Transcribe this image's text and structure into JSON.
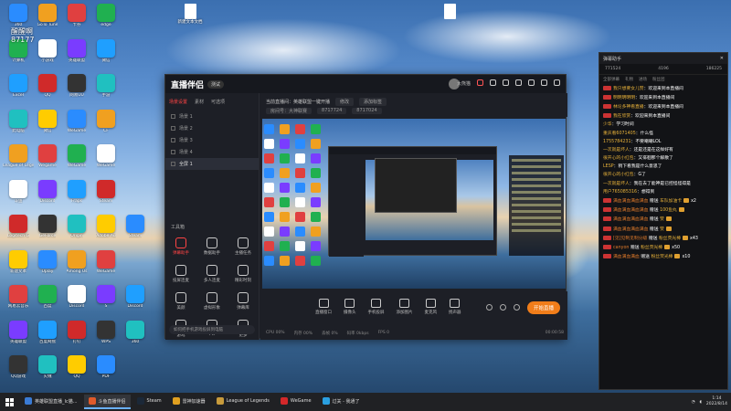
{
  "desktop": {
    "overlay_text": "醒醒啊",
    "overlay_num": "87177",
    "row_labels": [
      [
        "360",
        "GoTo Tune",
        "卡券",
        "edge",
        "",
        "新建文本文档"
      ],
      [
        "计算机",
        "小游戏",
        "英雄联盟",
        "微信",
        "",
        ""
      ],
      [
        "Excel",
        "QQ",
        "网易UU",
        "手游",
        "",
        ""
      ],
      [
        "此电脑",
        "微信",
        "WeGame",
        "CF",
        "",
        ""
      ],
      [
        "League of Legends",
        "Wegame",
        "WeGame",
        "WeGame",
        "",
        ""
      ],
      [
        "斗鱼",
        "Discord",
        "Fraps",
        "Steam",
        "",
        ""
      ],
      [
        "Logitech G",
        "GeForce",
        "Origin",
        "Adobe Au",
        "Steam",
        ""
      ],
      [
        "新建文本",
        "Uplay",
        "Among Us",
        "WeGame",
        "",
        ""
      ],
      [
        "网易云音乐",
        "百度",
        "Discord",
        "S",
        "Discord",
        ""
      ],
      [
        "英雄联盟",
        "百度网盘",
        "钉钉",
        "WPS",
        "360",
        ""
      ],
      [
        "QQ游戏",
        "火绒",
        "QQ",
        "PDF",
        "",
        ""
      ]
    ]
  },
  "window": {
    "app_name": "直播伴侣",
    "version": "测试",
    "user": "大熊猫",
    "sidebar_tabs": [
      "场景设置",
      "素材",
      "可选项"
    ],
    "scenes": [
      "场景 1",
      "场景 2",
      "场景 3",
      "场景 4",
      "全屏 1"
    ],
    "tools_header": "工具箱",
    "tools": [
      "弹幕助手",
      "数据助手",
      "主播任务",
      "投屏连麦",
      "多人连麦",
      "精彩时刻",
      "美颜",
      "虚拟形象",
      "弹幕库",
      "游戏",
      "PK",
      "更多"
    ],
    "sidebar_foot": "如何把手机游戏投屏到电脑",
    "topbar_line1": "当前直播间：英雄联盟一键开播",
    "topbar_btn1": "修改",
    "topbar_btn2": "添加标签",
    "topbar_line2_a": "房间号：大神联赛",
    "topbar_line2_b": "8717724",
    "topbar_line2_c": "8717024",
    "controls": [
      "直播窗口",
      "摄像头",
      "手机投屏",
      "添加图片",
      "麦克风",
      "扬声器"
    ],
    "go_live": "开始直播",
    "stats": [
      "CPU 00%",
      "内存 00%",
      "丢帧 0%",
      "码率 0kbps",
      "FPS 0"
    ],
    "timer": "00:00:58"
  },
  "chat": {
    "title": "弹幕助手",
    "stat1": "771524",
    "stat2": "4196",
    "stat3": "186225",
    "tabs": [
      "全部弹幕",
      "礼物",
      "进场",
      "粉丝团"
    ],
    "messages": [
      {
        "user": "我只想要女儿赞",
        "text": "欢迎来到本直播间"
      },
      {
        "user": "明明明明明",
        "text": "欢迎来到本直播间"
      },
      {
        "user": "林论多神看直播",
        "text": "欢迎来到本直播间"
      },
      {
        "user": "我在欣赏",
        "text": "欢迎来到本直播间"
      },
      {
        "user": "少华",
        "text": "学习时间"
      },
      {
        "user": "重庆看6071405",
        "text": "什么怪"
      },
      {
        "user": "1755784231",
        "text": "不要嘲嘲LOL"
      },
      {
        "user": "一次就是坏人",
        "text": "还是还是在这样好有"
      },
      {
        "user": "很开心的小红包",
        "text": "又徘徊那个解散了"
      },
      {
        "user": "LESP",
        "text": "稍下看我是什么意思了"
      },
      {
        "user": "很开心的小红包",
        "text": "G了"
      },
      {
        "user": "一次就是坏人",
        "text": "我在去了能神是已控怪怪得是"
      },
      {
        "user": "用户765085316",
        "text": "想得到"
      },
      {
        "user": "满血满血满血满血",
        "gift": "赠送",
        "item": "车队加油卡",
        "count": "x2"
      },
      {
        "user": "满血满血满血满血",
        "gift": "赠送",
        "item": "100鱼丸",
        "count": ""
      },
      {
        "user": "满血满血满血满血",
        "gift": "赠送",
        "item": "赞",
        "count": ""
      },
      {
        "user": "满血满血满血满血",
        "gift": "赠送",
        "item": "赞",
        "count": ""
      },
      {
        "user": "[见]见制见制分级",
        "gift": "赠送",
        "item": "粉丝荧光棒",
        "count": "x43"
      },
      {
        "user": "canyon",
        "gift": "赠送",
        "item": "粉丝荧光棒",
        "count": "x50"
      },
      {
        "user": "满血满血满血",
        "gift": "赠送",
        "item": "粉丝荧光棒",
        "count": "x10"
      }
    ]
  },
  "taskbar": {
    "tasks": [
      "英雄联盟直播_Ic猫...",
      "斗鱼直播伴侣",
      "Steam",
      "雷神加速器",
      "League of Legends",
      "WeGame",
      "过关 - 我通了"
    ],
    "time": "1:14",
    "date": "2022/8/14"
  }
}
